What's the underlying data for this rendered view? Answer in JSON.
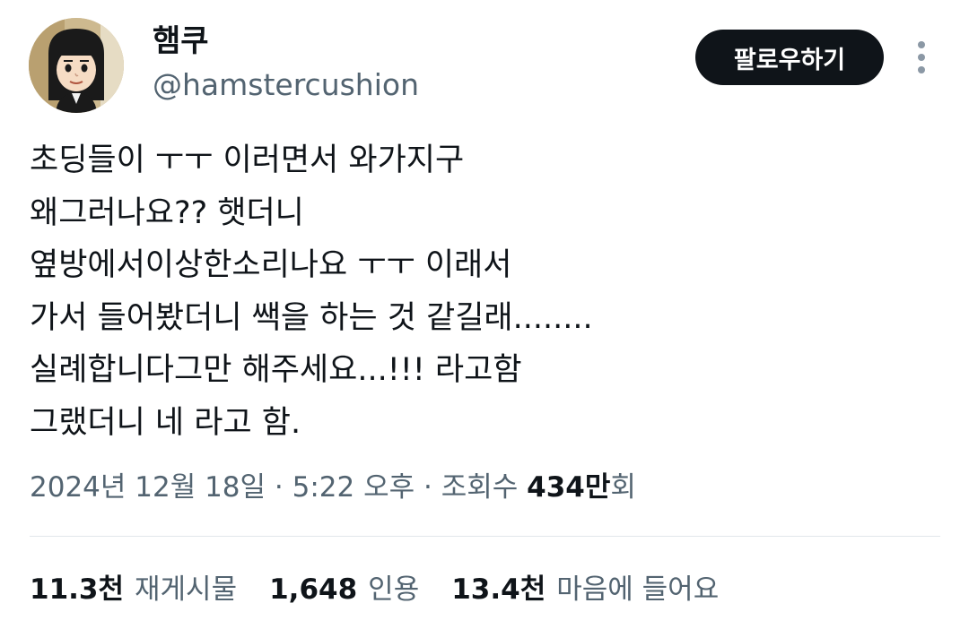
{
  "author": {
    "display_name": "햄쿠",
    "handle": "@hamstercushion",
    "avatar_icon": "mii-avatar-icon"
  },
  "follow_button": {
    "label": "팔로우하기"
  },
  "more_button": {
    "icon": "more-vertical-icon"
  },
  "tweet": {
    "lines": [
      "초딩들이 ㅜㅜ 이러면서 와가지구",
      "왜그러나요?? 햇더니",
      "옆방에서이상한소리나요 ㅜㅜ 이래서",
      "가서 들어봤더니 쌕을 하는 것 같길래........",
      "실례합니다그만 해주세요...!!! 라고함",
      "그랬더니 네 라고 함."
    ]
  },
  "meta": {
    "date": "2024년 12월 18일",
    "separator": " · ",
    "time": "5:22 오후",
    "views_label": "조회수",
    "views_count": "434만",
    "views_unit": "회"
  },
  "stats": {
    "retweets": {
      "count": "11.3천",
      "label": "재게시물"
    },
    "quotes": {
      "count": "1,648",
      "label": "인용"
    },
    "likes": {
      "count": "13.4천",
      "label": "마음에 들어요"
    }
  },
  "colors": {
    "text_primary": "#0f1419",
    "text_secondary": "#536471",
    "follow_button_bg": "#0f1419",
    "divider": "#e1e6ea"
  }
}
